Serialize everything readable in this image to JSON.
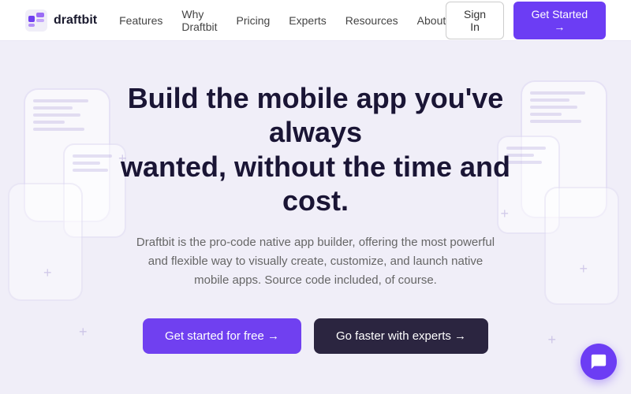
{
  "nav": {
    "logo_text": "draftbit",
    "links": [
      {
        "label": "Features",
        "id": "features"
      },
      {
        "label": "Why Draftbit",
        "id": "why-draftbit"
      },
      {
        "label": "Pricing",
        "id": "pricing"
      },
      {
        "label": "Experts",
        "id": "experts"
      },
      {
        "label": "Resources",
        "id": "resources"
      },
      {
        "label": "About",
        "id": "about"
      }
    ],
    "signin_label": "Sign In",
    "getstarted_label": "Get Started →"
  },
  "hero": {
    "title_line1": "Build the mobile app you've always",
    "title_line2": "wanted, without the time and cost.",
    "subtitle": "Draftbit is the pro-code native app builder, offering the most powerful and flexible way to visually create, customize, and launch native mobile apps. Source code included, of course.",
    "btn_primary_label": "Get started for free →",
    "btn_dark_label": "Go faster with experts →"
  },
  "chat": {
    "label": "chat-support"
  }
}
